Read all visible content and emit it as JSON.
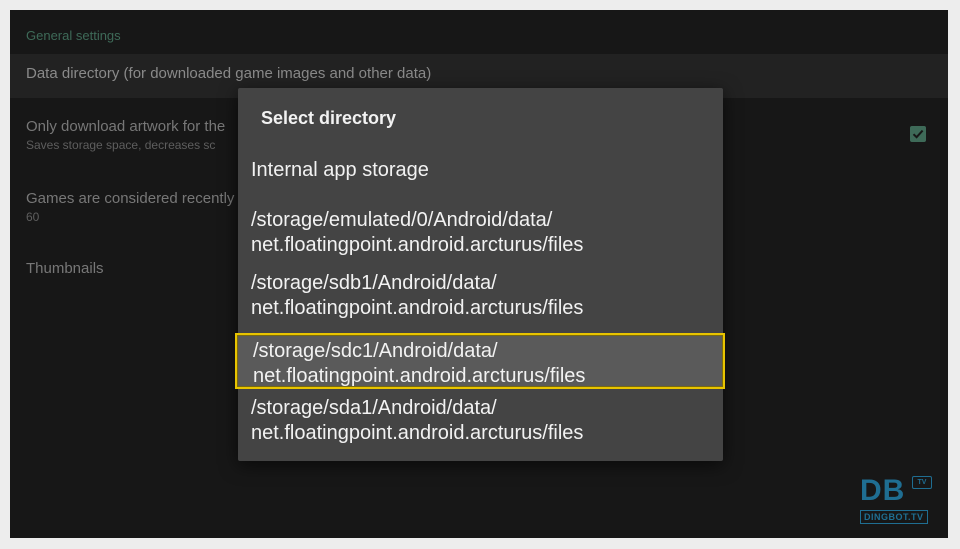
{
  "settings": {
    "section_header": "General settings",
    "data_directory": {
      "title": "Data directory (for downloaded game images and other data)"
    },
    "artwork": {
      "title": "Only download artwork for the",
      "subtitle": "Saves storage space, decreases sc",
      "checked": true
    },
    "recent": {
      "title": "Games are considered recently",
      "subtitle": "60"
    },
    "thumbnails": {
      "title": "Thumbnails"
    }
  },
  "dialog": {
    "title": "Select directory",
    "options": [
      {
        "line1": "Internal app storage",
        "line2": ""
      },
      {
        "line1": "/storage/emulated/0/Android/data/",
        "line2": "net.floatingpoint.android.arcturus/files"
      },
      {
        "line1": "/storage/sdb1/Android/data/",
        "line2": "net.floatingpoint.android.arcturus/files"
      },
      {
        "line1": "/storage/sdc1/Android/data/",
        "line2": "net.floatingpoint.android.arcturus/files"
      },
      {
        "line1": "/storage/sda1/Android/data/",
        "line2": "net.floatingpoint.android.arcturus/files"
      }
    ],
    "selected_index": 3
  },
  "watermark": {
    "logo": "DB",
    "tv": "TV",
    "text": "DINGBOT.TV"
  },
  "colors": {
    "accent": "#3e6a58",
    "focus_border": "#e8c400",
    "dialog_bg": "#444444",
    "background": "#171717"
  },
  "icons": {
    "checkbox": "check-icon"
  }
}
